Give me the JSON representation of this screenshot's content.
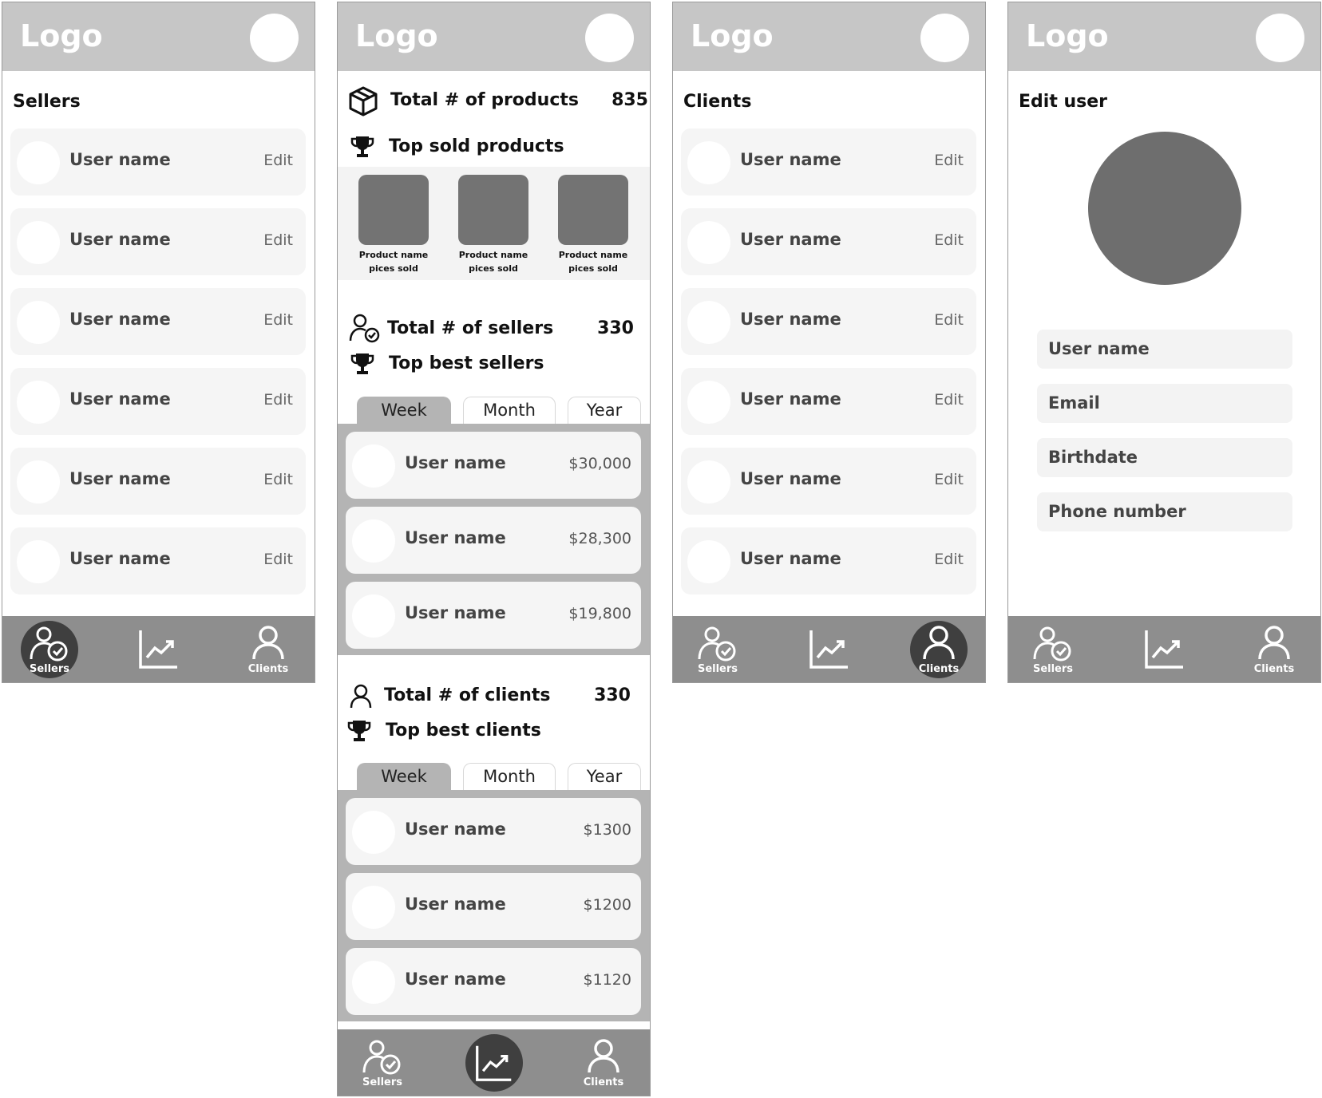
{
  "common": {
    "logo": "Logo",
    "nav": {
      "sellers": "Sellers",
      "clients": "Clients"
    }
  },
  "sellers_screen": {
    "title": "Sellers",
    "rows": [
      {
        "name": "User name",
        "action": "Edit"
      },
      {
        "name": "User name",
        "action": "Edit"
      },
      {
        "name": "User name",
        "action": "Edit"
      },
      {
        "name": "User name",
        "action": "Edit"
      },
      {
        "name": "User name",
        "action": "Edit"
      },
      {
        "name": "User name",
        "action": "Edit"
      }
    ]
  },
  "dashboard": {
    "products": {
      "label": "Total # of products",
      "value": "835",
      "top_label": "Top sold products",
      "items": [
        {
          "name": "Product name",
          "sold": "pices sold"
        },
        {
          "name": "Product name",
          "sold": "pices sold"
        },
        {
          "name": "Product name",
          "sold": "pices sold"
        }
      ]
    },
    "sellers": {
      "label": "Total # of sellers",
      "value": "330",
      "top_label": "Top best sellers",
      "tabs": [
        "Week",
        "Month",
        "Year"
      ],
      "rows": [
        {
          "name": "User name",
          "amount": "$30,000"
        },
        {
          "name": "User name",
          "amount": "$28,300"
        },
        {
          "name": "User name",
          "amount": "$19,800"
        }
      ]
    },
    "clients": {
      "label": "Total # of clients",
      "value": "330",
      "top_label": "Top best clients",
      "tabs": [
        "Week",
        "Month",
        "Year"
      ],
      "rows": [
        {
          "name": "User name",
          "amount": "$1300"
        },
        {
          "name": "User name",
          "amount": "$1200"
        },
        {
          "name": "User name",
          "amount": "$1120"
        }
      ]
    }
  },
  "clients_screen": {
    "title": "Clients",
    "rows": [
      {
        "name": "User name",
        "action": "Edit"
      },
      {
        "name": "User name",
        "action": "Edit"
      },
      {
        "name": "User name",
        "action": "Edit"
      },
      {
        "name": "User name",
        "action": "Edit"
      },
      {
        "name": "User name",
        "action": "Edit"
      },
      {
        "name": "User name",
        "action": "Edit"
      }
    ]
  },
  "edit_user": {
    "title": "Edit user",
    "fields": [
      "User name",
      "Email",
      "Birthdate",
      "Phone number"
    ]
  },
  "colors": {
    "topbar": "#c6c6c6",
    "bottombar": "#8e8e8e",
    "active_nav": "#3f3f3f",
    "panel": "#b4b4b4",
    "row": "#f5f5f5",
    "avatar_large": "#6e6e6e"
  },
  "icons": [
    "user-check-icon",
    "chart-line-icon",
    "user-icon",
    "box-icon",
    "trophy-icon"
  ]
}
